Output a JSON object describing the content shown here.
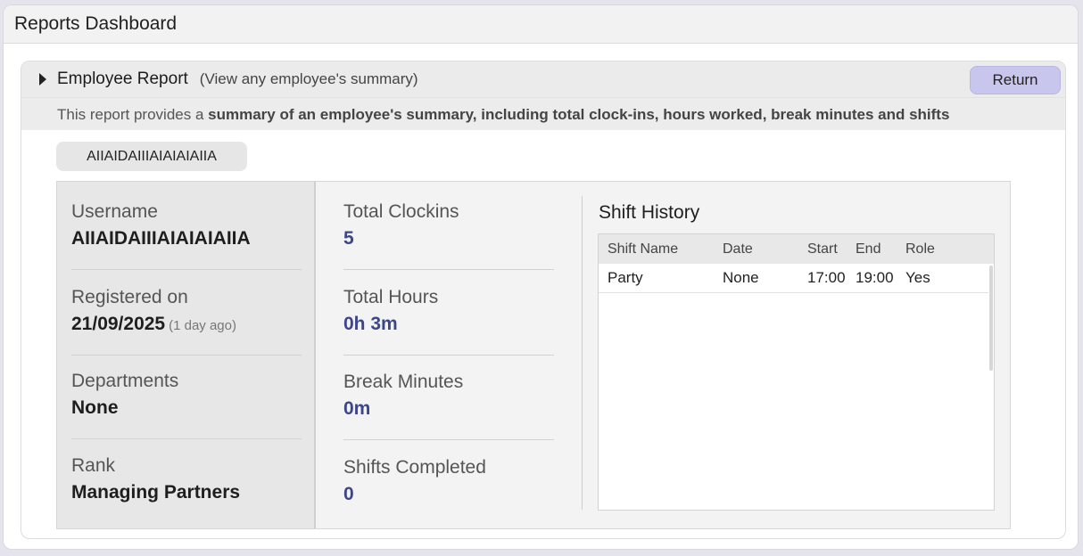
{
  "window": {
    "title": "Reports Dashboard"
  },
  "panel": {
    "title": "Employee Report",
    "subtitle": "(View any employee's summary)",
    "return_label": "Return",
    "description_prefix": "This report provides a ",
    "description_bold": "summary of an employee's summary, including total clock-ins, hours worked, break minutes and shifts"
  },
  "employee_chip": "AIIAIDAIIIAIAIAIAIIA",
  "profile": {
    "username_label": "Username",
    "username": "AIIAIDAIIIAIAIAIAIIA",
    "registered_label": "Registered on",
    "registered_date": "21/09/2025",
    "registered_ago": "(1 day ago)",
    "departments_label": "Departments",
    "departments": "None",
    "rank_label": "Rank",
    "rank": "Managing Partners"
  },
  "stats": {
    "clockins_label": "Total Clockins",
    "clockins": "5",
    "hours_label": "Total Hours",
    "hours": "0h 3m",
    "break_label": "Break Minutes",
    "break": "0m",
    "shifts_label": "Shifts Completed",
    "shifts": "0"
  },
  "shift_history": {
    "title": "Shift History",
    "columns": [
      "Shift Name",
      "Date",
      "Start",
      "End",
      "Role"
    ],
    "rows": [
      [
        "Party",
        "None",
        "17:00",
        "19:00",
        "Yes"
      ]
    ]
  },
  "colors": {
    "accent_button": "#c9c6ee",
    "stat_value": "#3c468a"
  }
}
